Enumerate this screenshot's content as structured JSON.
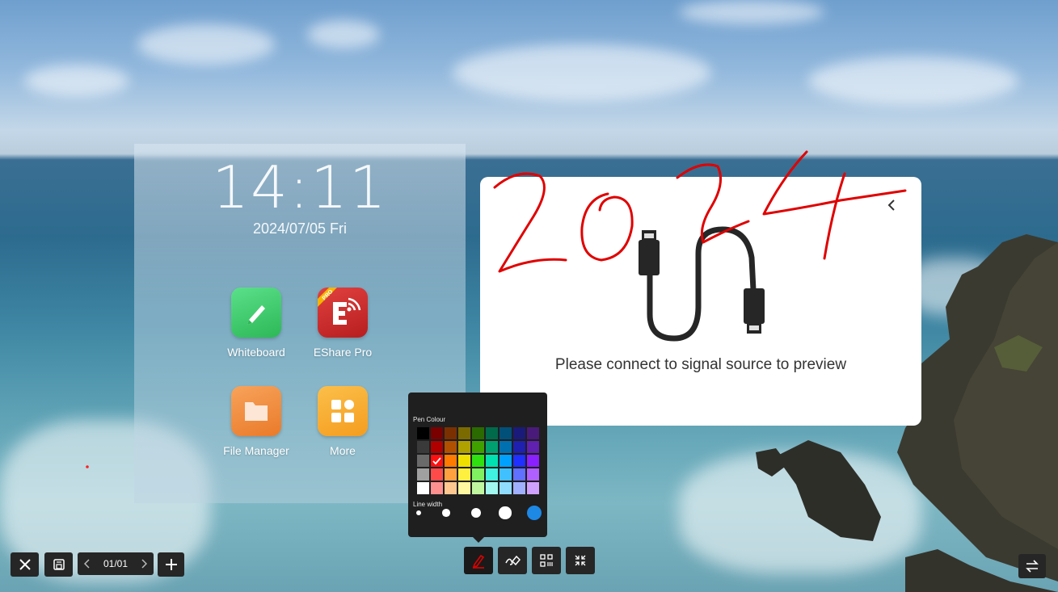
{
  "launcher": {
    "time": "14:11",
    "date": "2024/07/05 Fri",
    "apps": [
      {
        "label": "Whiteboard",
        "icon": "whiteboard-icon",
        "color": "#3fcf6c"
      },
      {
        "label": "EShare Pro",
        "icon": "eshare-pro-icon",
        "color": "#d32f2f"
      },
      {
        "label": "File Manager",
        "icon": "folder-icon",
        "color": "#f08a3c"
      },
      {
        "label": "More",
        "icon": "more-apps-icon",
        "color": "#f5a623"
      }
    ]
  },
  "preview": {
    "message": "Please connect to signal source to preview",
    "ink_text": "2024",
    "ink_color": "#e00000"
  },
  "pen_popup": {
    "title": "Pen Colour",
    "line_width_title": "Line width",
    "selected_color": "#ff1010",
    "colors": [
      [
        "#000000",
        "#7a0000",
        "#7a3000",
        "#7a6a00",
        "#2a6a00",
        "#006a4a",
        "#00507a",
        "#1a1a7a",
        "#4a1a7a"
      ],
      [
        "#3a3a3a",
        "#b00000",
        "#b05000",
        "#b0a000",
        "#40a000",
        "#00a070",
        "#0070b0",
        "#2020b0",
        "#6020b0"
      ],
      [
        "#6a6a6a",
        "#ff1010",
        "#ff7a00",
        "#f0e000",
        "#30e010",
        "#00e0b0",
        "#00a0ff",
        "#2030ff",
        "#8a20ff"
      ],
      [
        "#a0a0a0",
        "#ff4a4a",
        "#ffa040",
        "#fff040",
        "#80f060",
        "#40f0e0",
        "#40c0ff",
        "#6070ff",
        "#b060ff"
      ],
      [
        "#ffffff",
        "#ff9090",
        "#ffc890",
        "#fff8a0",
        "#c0f8a0",
        "#a0f8f0",
        "#90dcff",
        "#a0b0ff",
        "#d0a0ff"
      ]
    ],
    "line_widths": [
      1,
      2,
      3,
      4,
      5
    ],
    "selected_line_width": 5,
    "line_width_selected_color": "#1e88e5"
  },
  "bottom_left": {
    "close_icon": "close-icon",
    "save_icon": "save-icon",
    "page_label": "01/01",
    "prev_icon": "chevron-left-icon",
    "next_icon": "chevron-right-icon",
    "add_icon": "plus-icon"
  },
  "bottom_center": {
    "tools": [
      "pen-icon",
      "eraser-icon",
      "qr-code-icon",
      "minimize-icon"
    ],
    "active_tool": "pen-icon",
    "active_color": "#e00000"
  },
  "bottom_right": {
    "switch_icon": "switch-icon"
  }
}
